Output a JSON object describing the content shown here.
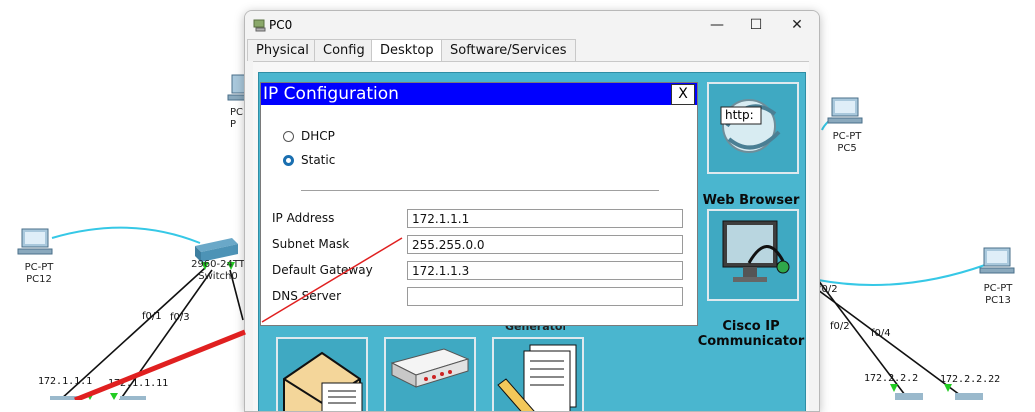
{
  "window": {
    "title": "PC0",
    "tabs": [
      {
        "label": "Physical"
      },
      {
        "label": "Config"
      },
      {
        "label": "Desktop"
      },
      {
        "label": "Software/Services"
      }
    ],
    "active_tab": "Desktop"
  },
  "ip_config": {
    "title": "IP Configuration",
    "close_label": "X",
    "mode_options": [
      {
        "label": "DHCP",
        "checked": false
      },
      {
        "label": "Static",
        "checked": true
      }
    ],
    "fields": [
      {
        "label": "IP Address",
        "value": "172.1.1.1"
      },
      {
        "label": "Subnet Mask",
        "value": "255.255.0.0"
      },
      {
        "label": "Default Gateway",
        "value": "172.1.1.3"
      },
      {
        "label": "DNS Server",
        "value": ""
      }
    ]
  },
  "desktop_apps": [
    {
      "name": "Web Browser",
      "icon": "web-browser-icon",
      "icon_text": "http:"
    },
    {
      "name": "Cisco IP Communicator",
      "name_line1": "Cisco IP",
      "name_line2": "Communicator",
      "icon": "ip-communicator-icon"
    }
  ],
  "partial_text": "Generator",
  "topology": {
    "devices": [
      {
        "line1": "PC-PT",
        "line2": "PC12"
      },
      {
        "line1": "PC-PT",
        "line2": "PC5"
      },
      {
        "line1": "PC-PT",
        "line2": "PC13"
      },
      {
        "line1": "2960-24TT",
        "line2": "Switch0"
      },
      {
        "line1": "PC",
        "line2": "P"
      }
    ],
    "ports": [
      "f0/1",
      "f0/3",
      "f0/2",
      "f0/2",
      "f0/4"
    ],
    "ips": [
      "172.1.1.1",
      "172.1.1.11",
      "172.2.2.2",
      "172.2.2.22"
    ]
  },
  "colors": {
    "ip_header": "#0000ff",
    "desktop_bg": "#4ab6cf",
    "cable": "#36c8e6",
    "annotation_arrow": "#e02020"
  }
}
